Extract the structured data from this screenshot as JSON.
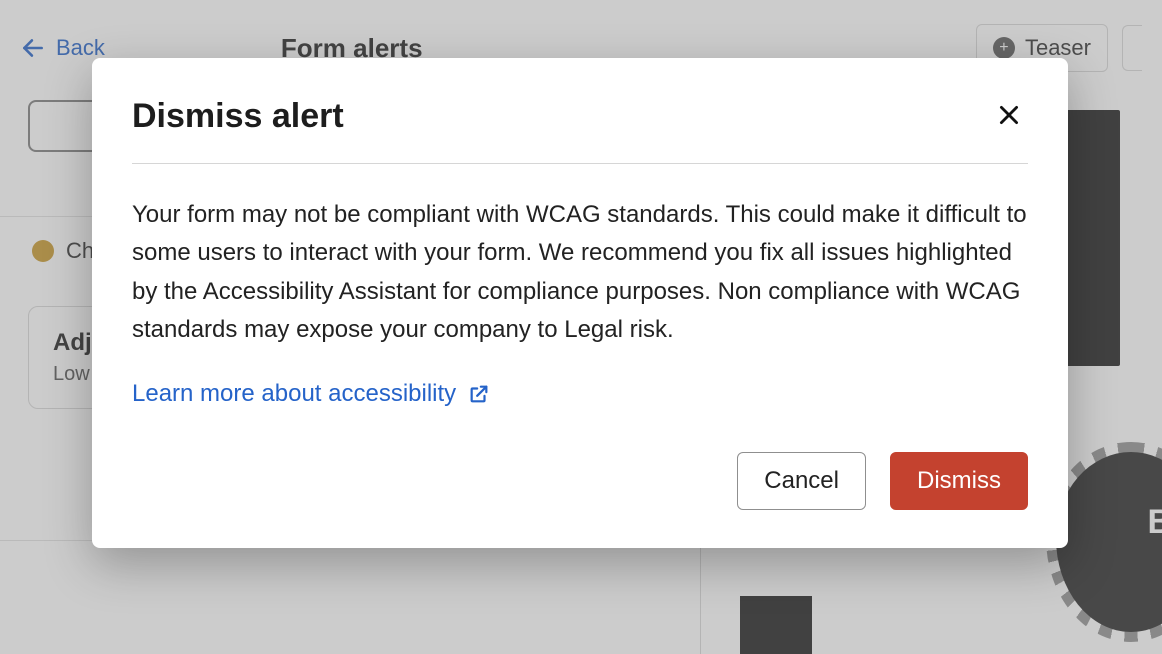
{
  "page": {
    "back_label": "Back",
    "title": "Form alerts",
    "teaser_label": "Teaser",
    "alert_row_text": "Ch",
    "card": {
      "title": "Adju",
      "subtitle": "Low"
    },
    "badge_text": "B"
  },
  "modal": {
    "title": "Dismiss alert",
    "body": "Your form may not be compliant with WCAG standards. This could make it difficult to some users to interact with your form. We recommend you fix all issues highlighted by the Accessibility Assistant for compliance purposes. Non compliance with WCAG standards may expose your company to Legal risk.",
    "learn_more_label": "Learn more about accessibility",
    "cancel_label": "Cancel",
    "dismiss_label": "Dismiss"
  }
}
